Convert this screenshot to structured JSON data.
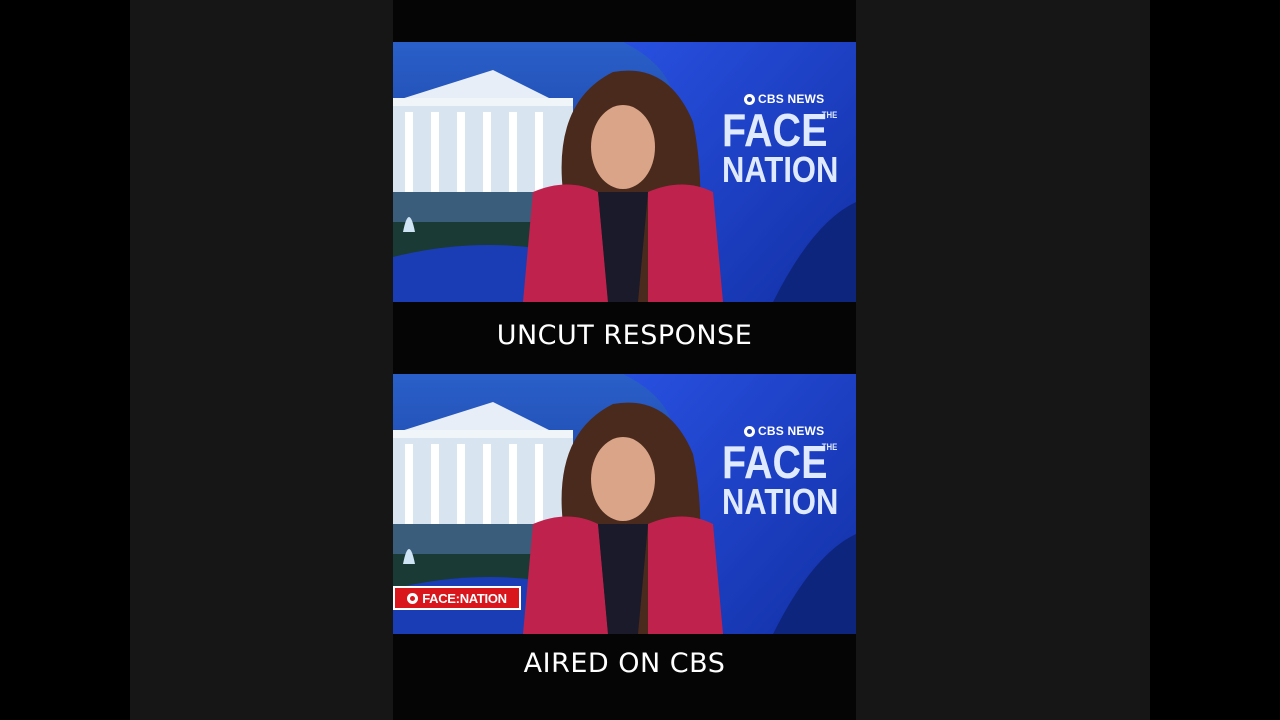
{
  "captions": {
    "top": "UNCUT RESPONSE",
    "bottom": "AIRED ON CBS"
  },
  "show_brand": {
    "network": "CBS NEWS",
    "word1": "FACE",
    "word_small": "THE",
    "word2": "NATION"
  },
  "lower_bug": {
    "label": "FACE:NATION"
  },
  "colors": {
    "backdrop_blue": "#1d3ec0",
    "blazer_magenta": "#c0224e",
    "bug_red": "#d9161c"
  }
}
